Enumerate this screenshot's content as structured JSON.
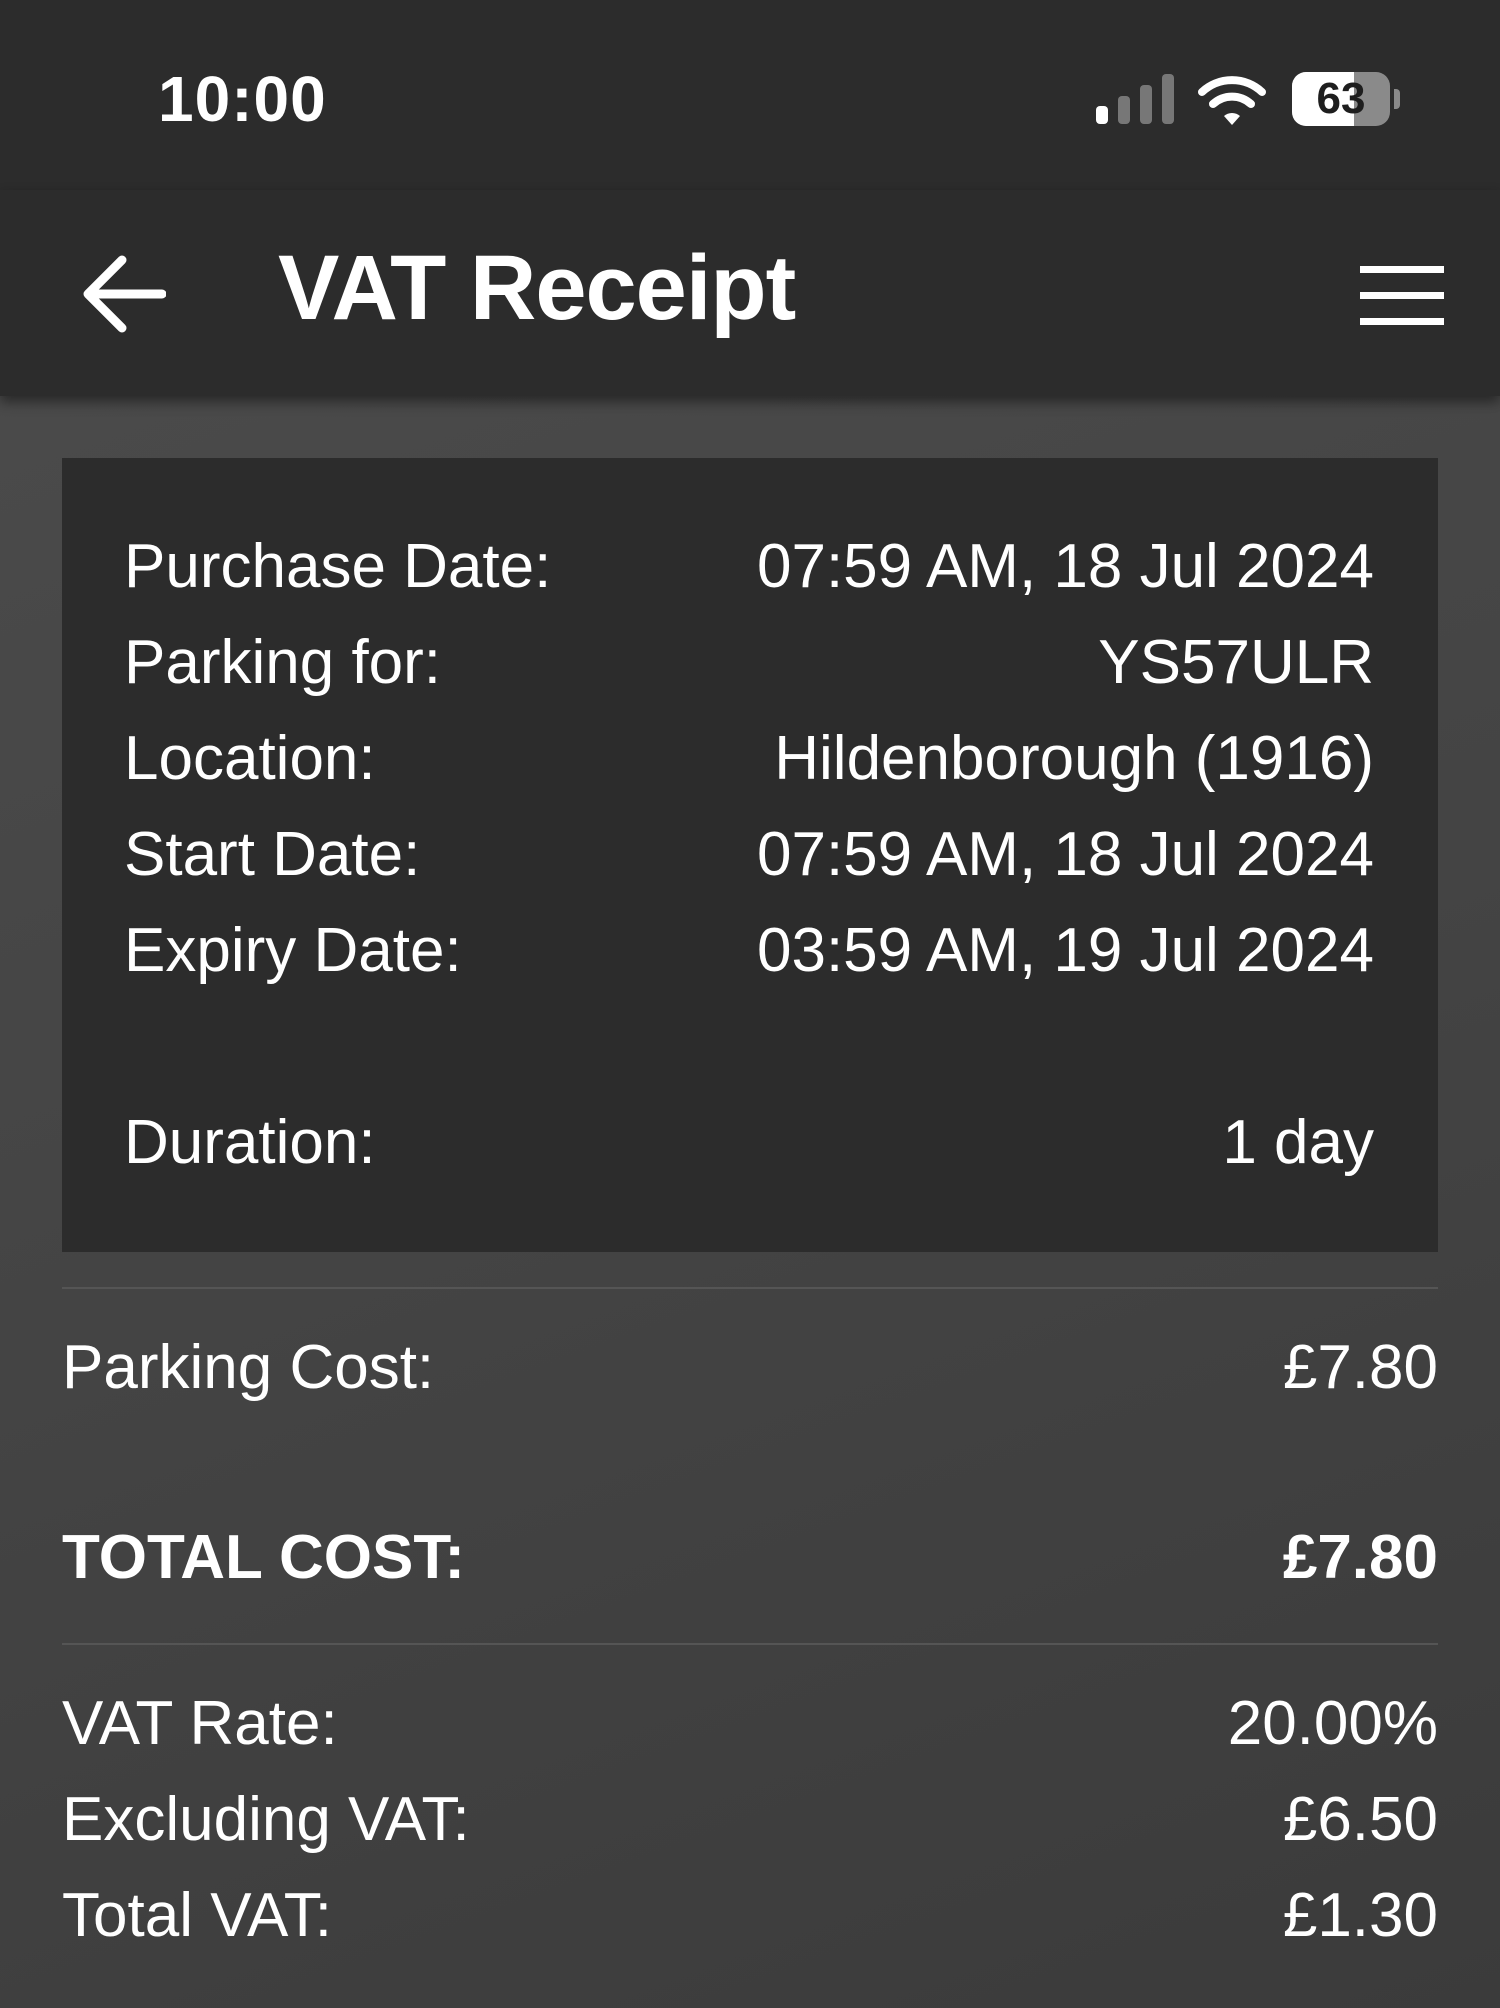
{
  "status_bar": {
    "time": "10:00",
    "battery_level": "63",
    "battery_fraction": 0.63
  },
  "app_bar": {
    "title": "VAT Receipt",
    "back_icon": "arrow-left-icon",
    "menu_icon": "hamburger-menu-icon"
  },
  "details": [
    {
      "label": "Purchase Date:",
      "value": "07:59 AM, 18 Jul 2024"
    },
    {
      "label": "Parking for:",
      "value": "YS57ULR"
    },
    {
      "label": "Location:",
      "value": "Hildenborough (1916)"
    },
    {
      "label": "Start Date:",
      "value": "07:59 AM, 18 Jul 2024"
    },
    {
      "label": "Expiry Date:",
      "value": "03:59 AM, 19 Jul 2024"
    },
    {
      "label": "Duration:",
      "value": "1 day"
    }
  ],
  "costs": {
    "parking_cost": {
      "label": "Parking Cost:",
      "value": "£7.80"
    },
    "total_cost": {
      "label": "TOTAL COST:",
      "value": "£7.80"
    }
  },
  "vat": [
    {
      "label": "VAT Rate:",
      "value": "20.00%"
    },
    {
      "label": "Excluding VAT:",
      "value": "£6.50"
    },
    {
      "label": "Total VAT:",
      "value": "£1.30"
    }
  ],
  "colors": {
    "bar_background": "#2c2c2c",
    "card_background": "#2c2c2c",
    "page_background": "#444444",
    "text": "#ffffff"
  }
}
